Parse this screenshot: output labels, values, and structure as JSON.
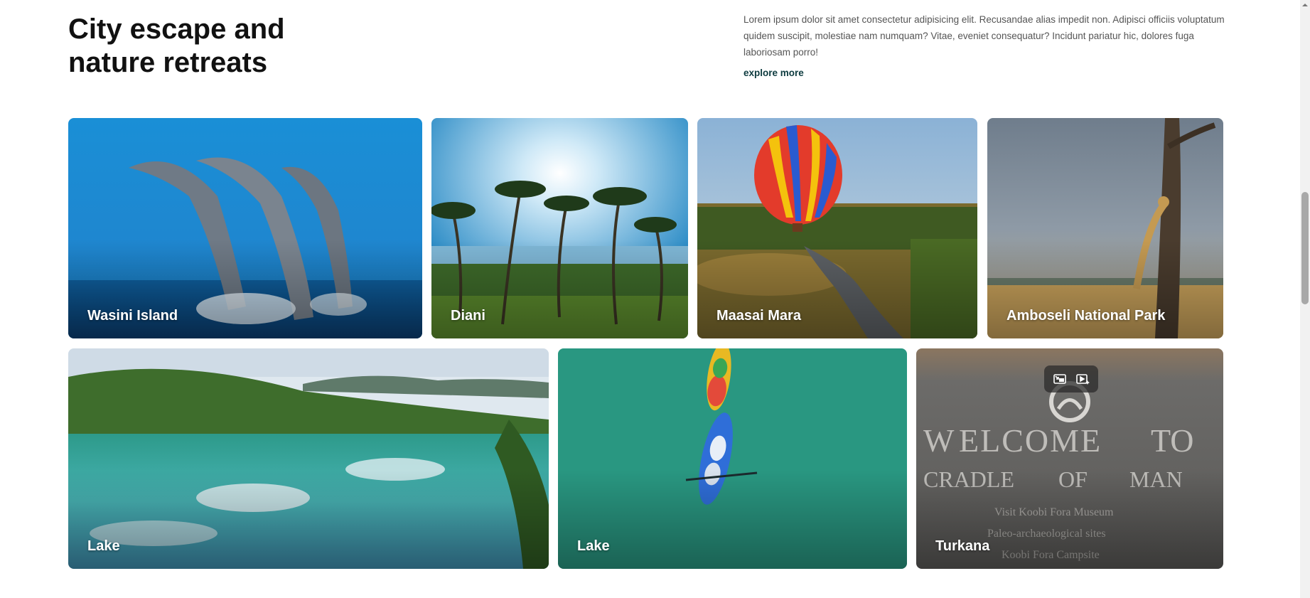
{
  "header": {
    "title": "City escape and nature retreats",
    "intro": "Lorem ipsum dolor sit amet consectetur adipisicing elit. Recusandae alias impedit non. Adipisci officiis voluptatum quidem suscipit, molestiae nam numquam? Vitae, eveniet consequatur? Incidunt pariatur hic, dolores fuga laboriosam porro!",
    "explore_label": "explore more"
  },
  "destinations": [
    {
      "label": "Wasini Island",
      "image": "dolphins-jumping-ocean"
    },
    {
      "label": "Diani",
      "image": "palm-beach"
    },
    {
      "label": "Maasai Mara",
      "image": "hot-air-balloon-river"
    },
    {
      "label": "Amboseli National Park",
      "image": "cheetah-tree-savanna"
    },
    {
      "label": "Lake",
      "image": "crater-lake-hills"
    },
    {
      "label": "Lake",
      "image": "kayaks-aerial-water"
    },
    {
      "label": "Turkana",
      "image": "welcome-sign-stone"
    }
  ],
  "video_controls": {
    "exit_pip_icon": "exit-picture-in-picture-icon",
    "play_icon": "video-play-sparkle-icon"
  },
  "colors": {
    "title": "#111111",
    "link": "#0d3b3f",
    "body_text": "#555555"
  }
}
